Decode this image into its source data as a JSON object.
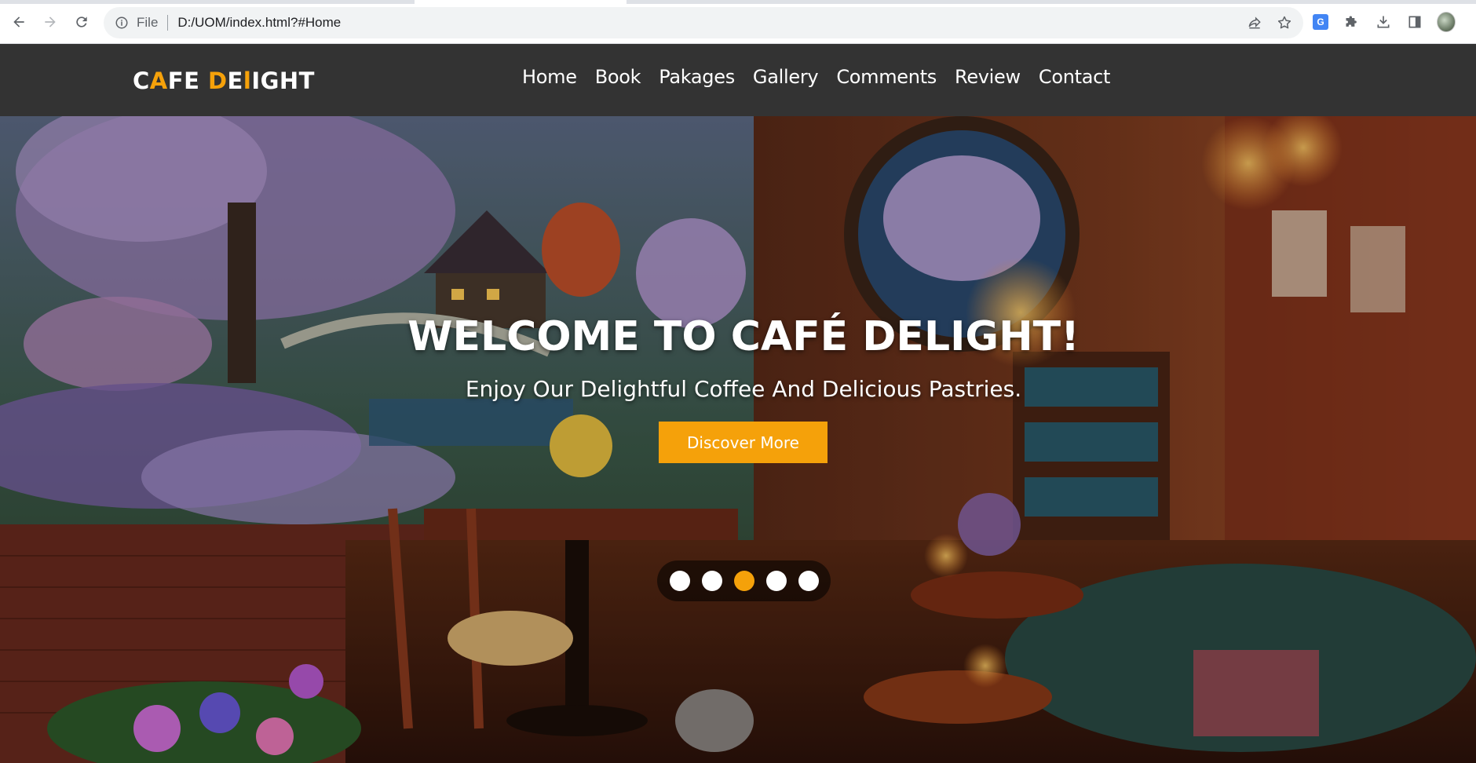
{
  "browser": {
    "scheme_label": "File",
    "url": "D:/UOM/index.html?#Home",
    "icons": [
      "back-icon",
      "forward-icon",
      "reload-icon",
      "info-icon",
      "share-icon",
      "star-icon",
      "google-translate-icon",
      "extensions-icon",
      "download-icon",
      "side-panel-icon",
      "profile-avatar"
    ]
  },
  "site": {
    "logo": {
      "part1": "C",
      "part2": "A",
      "part3": "F",
      "part4": "E ",
      "part5": "D",
      "part6": "E",
      "part7": "l",
      "part8": "IGHT"
    },
    "nav": [
      "Home",
      "Book",
      "Pakages",
      "Gallery",
      "Comments",
      "Review",
      "Contact"
    ]
  },
  "hero": {
    "title": "WELCOME TO CAFÉ DELIGHT!",
    "subtitle": "Enjoy Our Delightful Coffee And Delicious Pastries.",
    "button_label": "Discover More",
    "slides_count": 5,
    "active_slide": 3
  },
  "colors": {
    "accent": "#f5a10a",
    "nav_bg": "#333333",
    "text": "#ffffff"
  }
}
